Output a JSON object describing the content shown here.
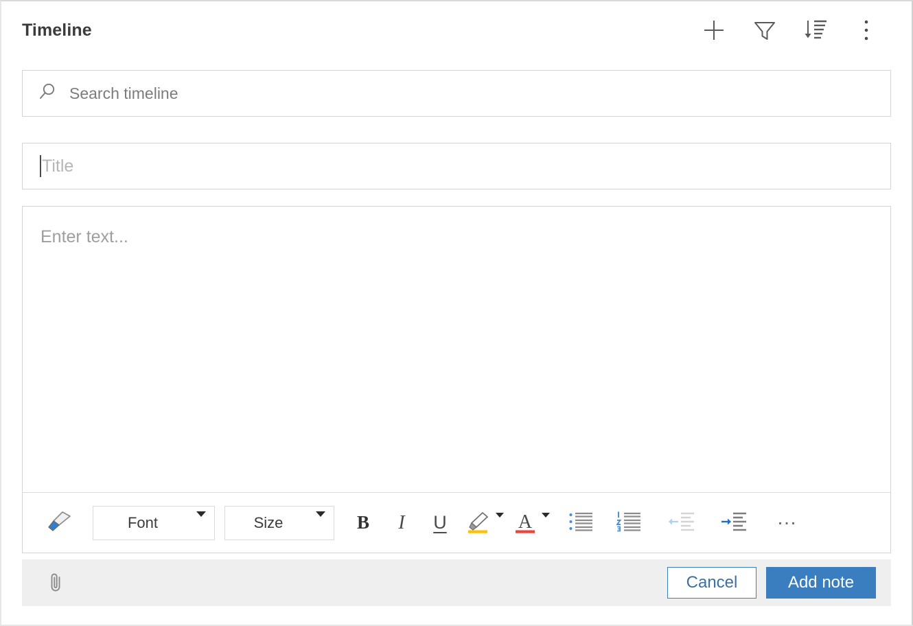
{
  "window": {
    "panel_title": "Timeline"
  },
  "header": {
    "actions": [
      {
        "name": "add",
        "label": "Add",
        "icon": "plus-icon"
      },
      {
        "name": "filter",
        "label": "Filter",
        "icon": "funnel-icon"
      },
      {
        "name": "sort",
        "label": "Sort",
        "icon": "sort-descending-icon"
      },
      {
        "name": "more",
        "label": "More options",
        "icon": "more-vertical-icon"
      }
    ]
  },
  "search": {
    "placeholder": "Search timeline",
    "value": "",
    "icon": "search-icon"
  },
  "note_form": {
    "title_field": {
      "placeholder": "Title",
      "value": "",
      "focused": true
    },
    "body_field": {
      "placeholder": "Enter text...",
      "value": ""
    }
  },
  "format_toolbar": {
    "format_painter": {
      "label": "Format painter",
      "icon": "paintbrush-icon"
    },
    "font": {
      "label": "Font",
      "caret": "chevron-down-icon"
    },
    "size": {
      "label": "Size",
      "caret": "chevron-down-icon"
    },
    "bold": {
      "label": "B",
      "name": "bold"
    },
    "italic": {
      "label": "I",
      "name": "italic"
    },
    "underline": {
      "label": "U",
      "name": "underline"
    },
    "highlight": {
      "label": "Text highlight color",
      "icon": "highlighter-icon",
      "color": "#ffc000"
    },
    "font_color": {
      "label": "Font color",
      "icon": "font-color-icon",
      "color": "#e8453c"
    },
    "bulleted_list": {
      "label": "Bulleted list",
      "icon": "bulleted-list-icon"
    },
    "numbered_list": {
      "label": "Numbered list",
      "icon": "numbered-list-icon"
    },
    "decrease_indent": {
      "label": "Decrease indent",
      "icon": "decrease-indent-icon",
      "disabled": true
    },
    "increase_indent": {
      "label": "Increase indent",
      "icon": "increase-indent-icon",
      "disabled": false
    },
    "more": {
      "label": "…",
      "name": "more-formatting"
    }
  },
  "footer": {
    "attach": {
      "label": "Attach file",
      "icon": "paperclip-icon"
    },
    "cancel_label": "Cancel",
    "add_note_label": "Add note"
  },
  "colors": {
    "accent_blue": "#3a7ebf",
    "panel_border": "#d4d4d4",
    "footer_background": "#efefef",
    "highlight_yellow": "#ffc000",
    "font_color_red": "#e8453c",
    "icon_grey": "#5a5a5a",
    "text_primary": "#3b3b3b",
    "placeholder_grey": "#9e9e9e"
  }
}
